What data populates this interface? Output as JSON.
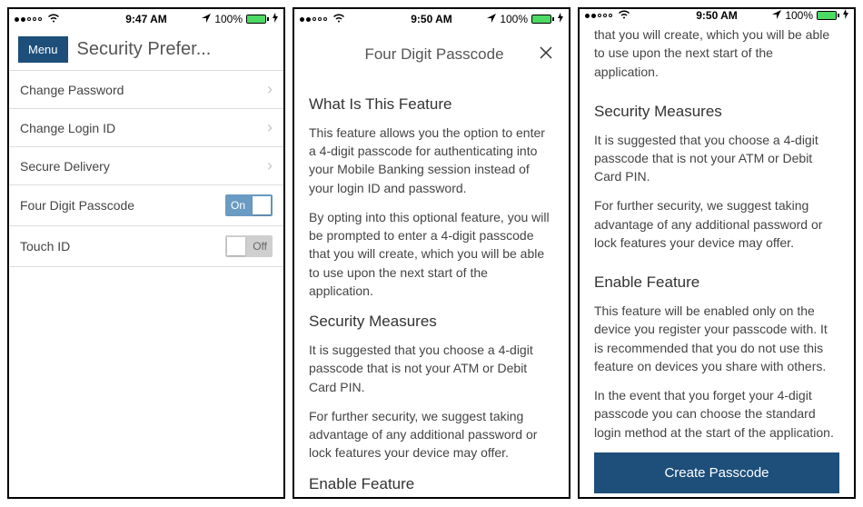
{
  "status": {
    "time1": "9:47 AM",
    "time2": "9:50 AM",
    "time3": "9:50 AM",
    "battery": "100%"
  },
  "screen1": {
    "menu": "Menu",
    "title": "Security Prefer...",
    "rows": {
      "changePassword": "Change Password",
      "changeLogin": "Change Login ID",
      "secureDelivery": "Secure Delivery",
      "fourDigit": "Four Digit Passcode",
      "touchId": "Touch ID"
    },
    "toggleOn": "On",
    "toggleOff": "Off"
  },
  "screen2": {
    "title": "Four Digit Passcode",
    "h1": "What Is This Feature",
    "p1": "This feature allows you the option to enter a 4-digit passcode for authenticating into your Mobile Banking session instead of your login ID and password.",
    "p2": "By opting into this optional feature, you will be prompted to enter a 4-digit passcode that you will create, which you will be able to use upon the next start of the application.",
    "h2": "Security Measures",
    "p3": "It is suggested that you choose a 4-digit passcode that is not your ATM or Debit Card PIN.",
    "p4": "For further security, we suggest taking advantage of any additional password or lock features your device may offer.",
    "h3": "Enable Feature"
  },
  "screen3": {
    "p0": "that you will create, which you will be able to use upon the next start of the application.",
    "h1": "Security Measures",
    "p1": "It is suggested that you choose a 4-digit passcode that is not your ATM or Debit Card PIN.",
    "p2": "For further security, we suggest taking advantage of any additional password or lock features your device may offer.",
    "h2": "Enable Feature",
    "p3": "This feature will be enabled only on the device you register your passcode with. It is recommended that you do not use this feature on devices you share with others.",
    "p4": "In the event that you forget your 4-digit passcode you can choose the standard login method at the start of the application.",
    "button": "Create Passcode"
  }
}
